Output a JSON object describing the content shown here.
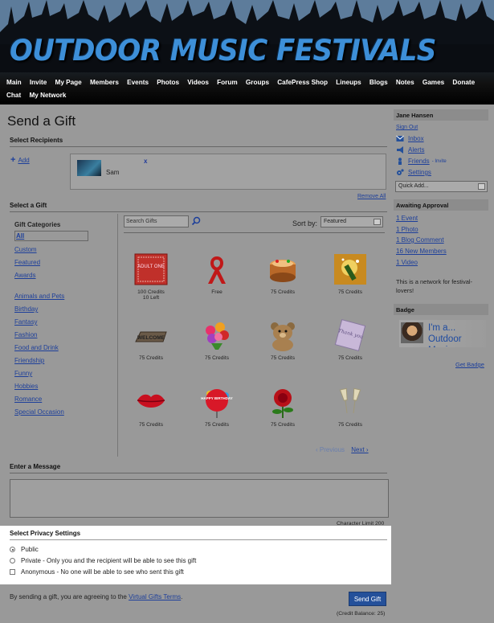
{
  "site": {
    "title": "OUTDOOR MUSIC FESTIVALS"
  },
  "nav": {
    "items": [
      "Main",
      "Invite",
      "My Page",
      "Members",
      "Events",
      "Photos",
      "Videos",
      "Forum",
      "Groups",
      "CafePress Shop",
      "Lineups",
      "Blogs",
      "Notes",
      "Games",
      "Donate",
      "Chat",
      "My Network"
    ]
  },
  "page": {
    "title": "Send a Gift",
    "recipients": {
      "title": "Select Recipients",
      "add_label": "Add",
      "name": "Sam",
      "remove_x": "x",
      "remove_all": "Remove All"
    },
    "select_gift": {
      "title": "Select a Gift",
      "categories_title": "Gift Categories",
      "categories_top": [
        "All",
        "Custom",
        "Featured",
        "Awards"
      ],
      "categories_bottom": [
        "Animals and Pets",
        "Birthday",
        "Fantasy",
        "Fashion",
        "Food and Drink",
        "Friendship",
        "Funny",
        "Hobbies",
        "Romance",
        "Special Occasion"
      ],
      "search_placeholder": "Search Gifts",
      "sort_label": "Sort by:",
      "sort_value": "Featured",
      "gifts": [
        {
          "icon": "adult-one-sign",
          "label": "100 Credits",
          "sub": "10 Left"
        },
        {
          "icon": "red-ribbon",
          "label": "Free",
          "sub": ""
        },
        {
          "icon": "cake",
          "label": "75 Credits",
          "sub": ""
        },
        {
          "icon": "champagne-toast",
          "label": "75 Credits",
          "sub": ""
        },
        {
          "icon": "welcome-mat",
          "label": "75 Credits",
          "sub": ""
        },
        {
          "icon": "flower-bouquet",
          "label": "75 Credits",
          "sub": ""
        },
        {
          "icon": "teddy-bear",
          "label": "75 Credits",
          "sub": ""
        },
        {
          "icon": "thank-you-card",
          "label": "75 Credits",
          "sub": ""
        },
        {
          "icon": "kiss-lips",
          "label": "75 Credits",
          "sub": ""
        },
        {
          "icon": "birthday-balloon",
          "label": "75 Credits",
          "sub": ""
        },
        {
          "icon": "red-rose",
          "label": "75 Credits",
          "sub": ""
        },
        {
          "icon": "champagne-glasses",
          "label": "75 Credits",
          "sub": ""
        }
      ],
      "welcome_text": "WELCOME",
      "thank_you_text": "Thank you",
      "happy_birthday_text": "HAPPY BIRTHDAY",
      "adult_text": "ADULT ONE",
      "prev_label": "‹ Previous",
      "next_label": "Next ›"
    },
    "message": {
      "title": "Enter a Message",
      "char_limit": "Character Limit 200"
    },
    "privacy": {
      "title": "Select Privacy Settings",
      "public": "Public",
      "private": "Private - Only you and the recipient will be able to see this gift",
      "anonymous": "Anonymous - No one will be able to see who sent this gift"
    },
    "terms_text": "By sending a gift, you are agreeing to the",
    "terms_link": "Virtual Gifts Terms",
    "terms_end": ".",
    "send_label": "Send Gift",
    "credit_balance": "(Credit Balance: 25)"
  },
  "sidebar": {
    "user": "Jane Hansen",
    "sign_out": "Sign Out",
    "inbox": "Inbox",
    "alerts": "Alerts",
    "friends": "Friends",
    "invite": "- Invite",
    "settings": "Settings",
    "quick_add": "Quick Add...",
    "awaiting_title": "Awaiting Approval",
    "awaiting": [
      "1 Event",
      "1 Photo",
      "1 Blog Comment",
      "16 New Members",
      "1 Video"
    ],
    "network_desc": "This is a network for festival-lovers!",
    "badge_title": "Badge",
    "badge_text": "I'm a... Outdoor Music...",
    "get_badge": "Get Badge"
  }
}
